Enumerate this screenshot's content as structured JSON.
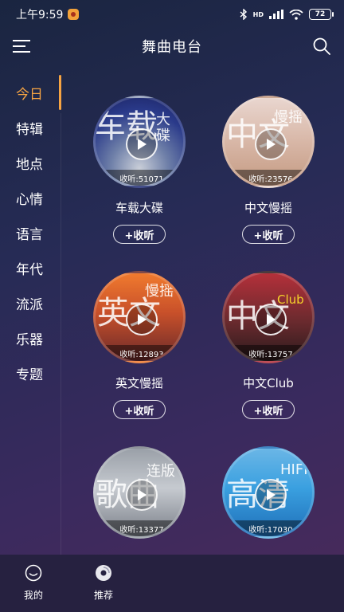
{
  "status_bar": {
    "time": "上午9:59",
    "network": "HD",
    "battery": "72"
  },
  "header": {
    "title": "舞曲电台"
  },
  "sidebar": {
    "items": [
      {
        "label": "今日",
        "active": true
      },
      {
        "label": "特辑"
      },
      {
        "label": "地点"
      },
      {
        "label": "心情"
      },
      {
        "label": "语言"
      },
      {
        "label": "年代"
      },
      {
        "label": "流派"
      },
      {
        "label": "乐器"
      },
      {
        "label": "专题"
      }
    ]
  },
  "stations": [
    {
      "name": "车载大碟",
      "listens": "收听:51071",
      "cover_big": "车载",
      "cover_small": "大碟",
      "collect": "+收听"
    },
    {
      "name": "中文慢摇",
      "listens": "收听:23576",
      "cover_big": "中文",
      "cover_small": "慢摇",
      "collect": "+收听"
    },
    {
      "name": "英文慢摇",
      "listens": "收听:12893",
      "cover_big": "英文",
      "cover_small": "慢摇",
      "collect": "+收听"
    },
    {
      "name": "中文Club",
      "listens": "收听:13757",
      "cover_big": "中文",
      "cover_small": "Club",
      "collect": "+收听"
    },
    {
      "name": "",
      "listens": "收听:13377",
      "cover_big": "歌曲",
      "cover_small": "连版",
      "collect": ""
    },
    {
      "name": "",
      "listens": "收听:17030",
      "cover_big": "高清",
      "cover_small": "HIFI",
      "collect": ""
    }
  ],
  "bottom_nav": {
    "mine": "我的",
    "recommend": "推荐"
  },
  "colors": {
    "accent": "#f6a443"
  }
}
